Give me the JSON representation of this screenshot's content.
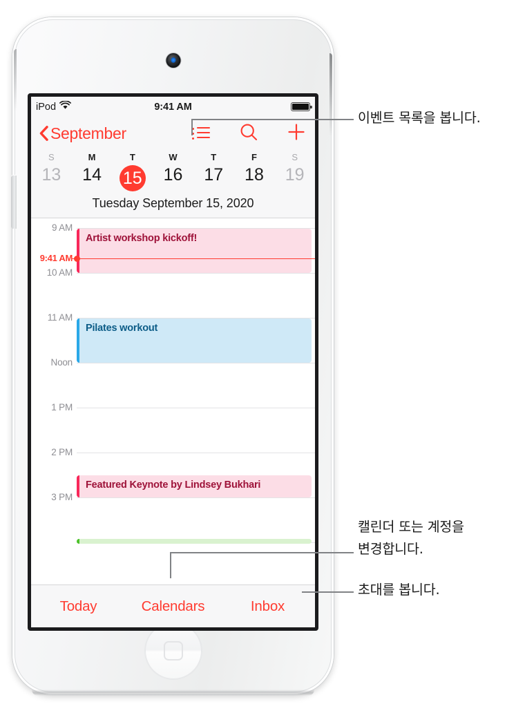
{
  "device": {
    "name": "ipod-touch",
    "camera_icon": "camera-icon",
    "home_button_icon": "home-button-icon",
    "volume_button": "volume-button"
  },
  "status_bar": {
    "carrier": "iPod",
    "wifi_icon": "wifi-icon",
    "time": "9:41 AM",
    "battery_icon": "battery-full-icon"
  },
  "nav_bar": {
    "back_label": "September",
    "back_chevron_icon": "chevron-left-icon",
    "list_icon": "list-icon",
    "search_icon": "search-icon",
    "add_icon": "plus-icon",
    "accent_color": "#ff3b30"
  },
  "week_strip": {
    "day_initials": [
      "S",
      "M",
      "T",
      "W",
      "T",
      "F",
      "S"
    ],
    "dates": [
      "13",
      "14",
      "15",
      "16",
      "17",
      "18",
      "19"
    ],
    "selected_date": "15",
    "selected_index": 2,
    "dim_indices": [
      0,
      6
    ],
    "full_date": "Tuesday  September 15, 2020"
  },
  "day_grid": {
    "hours": [
      "9 AM",
      "10 AM",
      "11 AM",
      "Noon",
      "1 PM",
      "2 PM",
      "3 PM"
    ],
    "now_indicator": {
      "label": "9:41 AM",
      "color": "#ff3b30"
    },
    "events": [
      {
        "title": "Artist workshop kickoff!",
        "color": "#f8285a",
        "fill": "#fcdde6",
        "start": "9 AM",
        "end": "10 AM"
      },
      {
        "title": "Pilates workout",
        "color": "#2aa8e8",
        "fill": "#cfe9f7",
        "start": "11 AM",
        "end": "Noon"
      },
      {
        "title": "Featured Keynote by Lindsey Bukhari",
        "color": "#f8285a",
        "fill": "#fcdde6",
        "start": "2:30 PM",
        "end": "3 PM"
      },
      {
        "title": "",
        "color": "#4cc22a",
        "fill": "#d9f2cf",
        "start": "4 PM",
        "end": "4 PM"
      }
    ]
  },
  "tab_bar": {
    "items": [
      "Today",
      "Calendars",
      "Inbox"
    ]
  },
  "callouts": [
    {
      "name": "list-callout",
      "text": "이벤트 목록을 봅니다."
    },
    {
      "name": "calendars-callout",
      "text": "캘린더 또는 계정을\n변경합니다."
    },
    {
      "name": "calendars-callout-line1",
      "text": "캘린더 또는 계정을"
    },
    {
      "name": "calendars-callout-line2",
      "text": "변경합니다."
    },
    {
      "name": "inbox-callout",
      "text": "초대를 봅니다."
    }
  ]
}
